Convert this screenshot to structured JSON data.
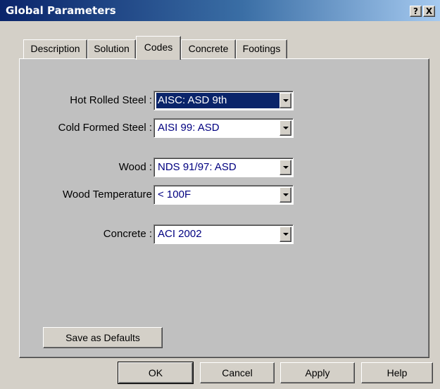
{
  "window": {
    "title": "Global Parameters",
    "help_button": "?",
    "close_button": "X"
  },
  "tabs": [
    {
      "label": "Description",
      "active": false
    },
    {
      "label": "Solution",
      "active": false
    },
    {
      "label": "Codes",
      "active": true
    },
    {
      "label": "Concrete",
      "active": false
    },
    {
      "label": "Footings",
      "active": false
    }
  ],
  "fields": {
    "hot_rolled_steel": {
      "label": "Hot Rolled Steel :",
      "value": "AISC: ASD 9th",
      "selected": true
    },
    "cold_formed_steel": {
      "label": "Cold Formed Steel :",
      "value": "AISI 99: ASD"
    },
    "wood": {
      "label": "Wood :",
      "value": "NDS 91/97: ASD"
    },
    "wood_temperature": {
      "label": "Wood Temperature",
      "value": "< 100F"
    },
    "concrete": {
      "label": "Concrete :",
      "value": "ACI 2002"
    }
  },
  "buttons": {
    "save_defaults": "Save as Defaults",
    "ok": "OK",
    "cancel": "Cancel",
    "apply": "Apply",
    "help": "Help"
  },
  "colors": {
    "title_bar": "#0a246a",
    "dialog_face": "#d4d0c8",
    "panel_face": "#c0c0c0",
    "selection": "#0a246a",
    "value_text": "#000080"
  }
}
